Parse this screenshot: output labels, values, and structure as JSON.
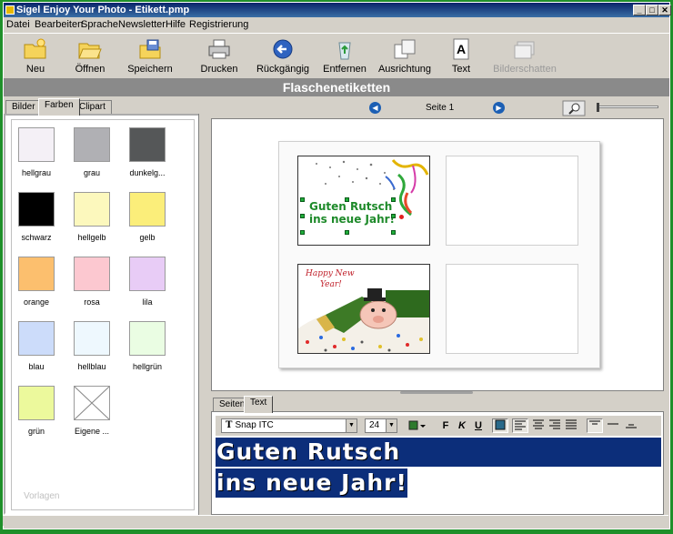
{
  "window": {
    "title": "Sigel Enjoy Your Photo - Etikett.pmp"
  },
  "menu": [
    "Datei",
    "Bearbeiten",
    "Sprache",
    "Newsletter",
    "Hilfe",
    "Registrierung"
  ],
  "toolbar": [
    {
      "label": "Neu",
      "icon": "new-folder-icon"
    },
    {
      "label": "Öffnen",
      "icon": "open-folder-icon"
    },
    {
      "label": "Speichern",
      "icon": "save-icon"
    },
    {
      "label": "Drucken",
      "icon": "printer-icon"
    },
    {
      "label": "Rückgängig",
      "icon": "undo-icon"
    },
    {
      "label": "Entfernen",
      "icon": "recycle-bin-icon"
    },
    {
      "label": "Ausrichtung",
      "icon": "pages-icon"
    },
    {
      "label": "Text",
      "icon": "text-icon"
    },
    {
      "label": "Bilderschatten",
      "icon": "shadow-icon",
      "disabled": true
    }
  ],
  "banner": "Flaschenetiketten",
  "left_tabs": [
    "Bilder",
    "Farben",
    "Clipart"
  ],
  "active_left_tab": "Farben",
  "swatches": [
    {
      "label": "hellgrau",
      "color": "#f4f0f6"
    },
    {
      "label": "grau",
      "color": "#b0b0b4"
    },
    {
      "label": "dunkelg...",
      "color": "#555758"
    },
    {
      "label": "schwarz",
      "color": "#000000"
    },
    {
      "label": "hellgelb",
      "color": "#fcf8bd"
    },
    {
      "label": "gelb",
      "color": "#fbee7a"
    },
    {
      "label": "orange",
      "color": "#fcbf6e"
    },
    {
      "label": "rosa",
      "color": "#fcc8d0"
    },
    {
      "label": "lila",
      "color": "#e8ccf6"
    },
    {
      "label": "blau",
      "color": "#ccdcfa"
    },
    {
      "label": "hellblau",
      "color": "#eef8fe"
    },
    {
      "label": "hellgrün",
      "color": "#eafde3"
    },
    {
      "label": "grün",
      "color": "#ecf99c"
    },
    {
      "label": "Eigene ...",
      "color": "none"
    }
  ],
  "vorlagen": "Vorlagen",
  "nav": {
    "page_label": "Seite 1"
  },
  "labels": {
    "label1_text": [
      "Guten Rutsch",
      "ins neue Jahr!"
    ],
    "label3_text": [
      "Happy New",
      "Year!"
    ]
  },
  "bottom_tabs": [
    "Seiten",
    "Text"
  ],
  "active_bottom_tab": "Text",
  "format": {
    "font": "Snap ITC",
    "size": "24",
    "bold": "F",
    "italic": "K",
    "underline": "U"
  },
  "editor_text": [
    "Guten Rutsch",
    "ins neue Jahr!"
  ],
  "colors": {
    "title_bar": "#0a246a",
    "banner": "#8a8a8a",
    "selection": "#0c2e7a",
    "label_text": "#1e8a2a",
    "desktop": "#1f8f2a"
  }
}
